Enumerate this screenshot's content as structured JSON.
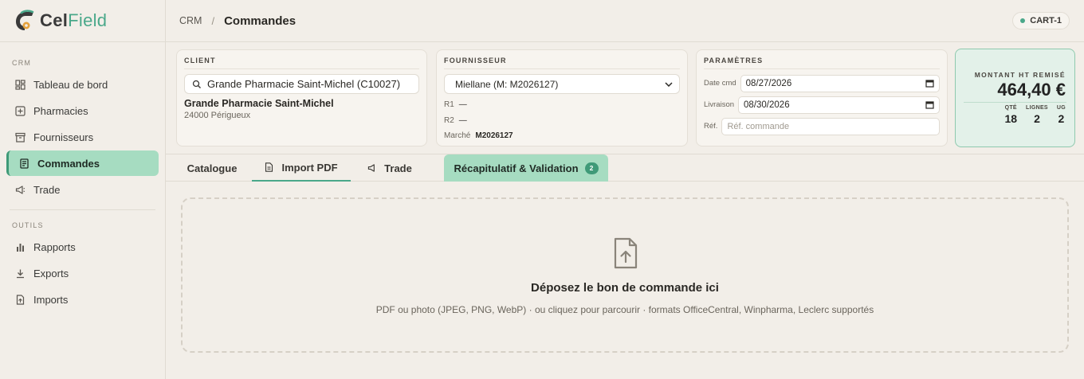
{
  "brand": {
    "part1": "Cel",
    "part2": "Field"
  },
  "sidebar": {
    "section_crm": "CRM",
    "section_tools": "OUTILS",
    "items": [
      {
        "label": "Tableau de bord",
        "icon": "dashboard-icon"
      },
      {
        "label": "Pharmacies",
        "icon": "pharmacy-icon"
      },
      {
        "label": "Fournisseurs",
        "icon": "supplier-icon"
      },
      {
        "label": "Commandes",
        "icon": "orders-icon",
        "active": true
      },
      {
        "label": "Trade",
        "icon": "megaphone-icon"
      },
      {
        "label": "Rapports",
        "icon": "bar-chart-icon"
      },
      {
        "label": "Exports",
        "icon": "download-icon"
      },
      {
        "label": "Imports",
        "icon": "file-upload-icon"
      }
    ]
  },
  "header": {
    "breadcrumb_root": "CRM",
    "breadcrumb_sep": "/",
    "title": "Commandes",
    "cart_badge": "CART-1"
  },
  "client": {
    "label": "CLIENT",
    "search_value": "Grande Pharmacie Saint-Michel (C10027)",
    "name": "Grande Pharmacie Saint-Michel",
    "city": "24000 Périgueux"
  },
  "supplier": {
    "label": "FOURNISSEUR",
    "selected": "Miellane (M: M2026127)",
    "r1_label": "R1",
    "r1_value": "—",
    "r2_label": "R2",
    "r2_value": "—",
    "market_label": "Marché",
    "market_value": "M2026127"
  },
  "params": {
    "label": "PARAMÈTRES",
    "date_cmd_label": "Date cmd",
    "date_cmd_value": "08/27/2026",
    "delivery_label": "Livraison",
    "delivery_value": "08/30/2026",
    "ref_label": "Réf.",
    "ref_placeholder": "Réf. commande"
  },
  "totals": {
    "label": "MONTANT HT REMISÉ",
    "amount": "464,40 €",
    "qty_label": "QTÉ",
    "qty_value": "18",
    "lines_label": "LIGNES",
    "lines_value": "2",
    "ug_label": "UG",
    "ug_value": "2"
  },
  "tabs": {
    "catalogue": "Catalogue",
    "import_pdf": "Import PDF",
    "trade": "Trade",
    "summary": "Récapitulatif & Validation",
    "summary_count": "2"
  },
  "dropzone": {
    "title": "Déposez le bon de commande ici",
    "subtitle": "PDF ou photo (JPEG, PNG, WebP) · ou cliquez pour parcourir · formats OfficeCentral, Winpharma, Leclerc supportés"
  },
  "colors": {
    "accent": "#4aa88a",
    "active_bg": "#a6dcc1",
    "background": "#f2eee8"
  }
}
